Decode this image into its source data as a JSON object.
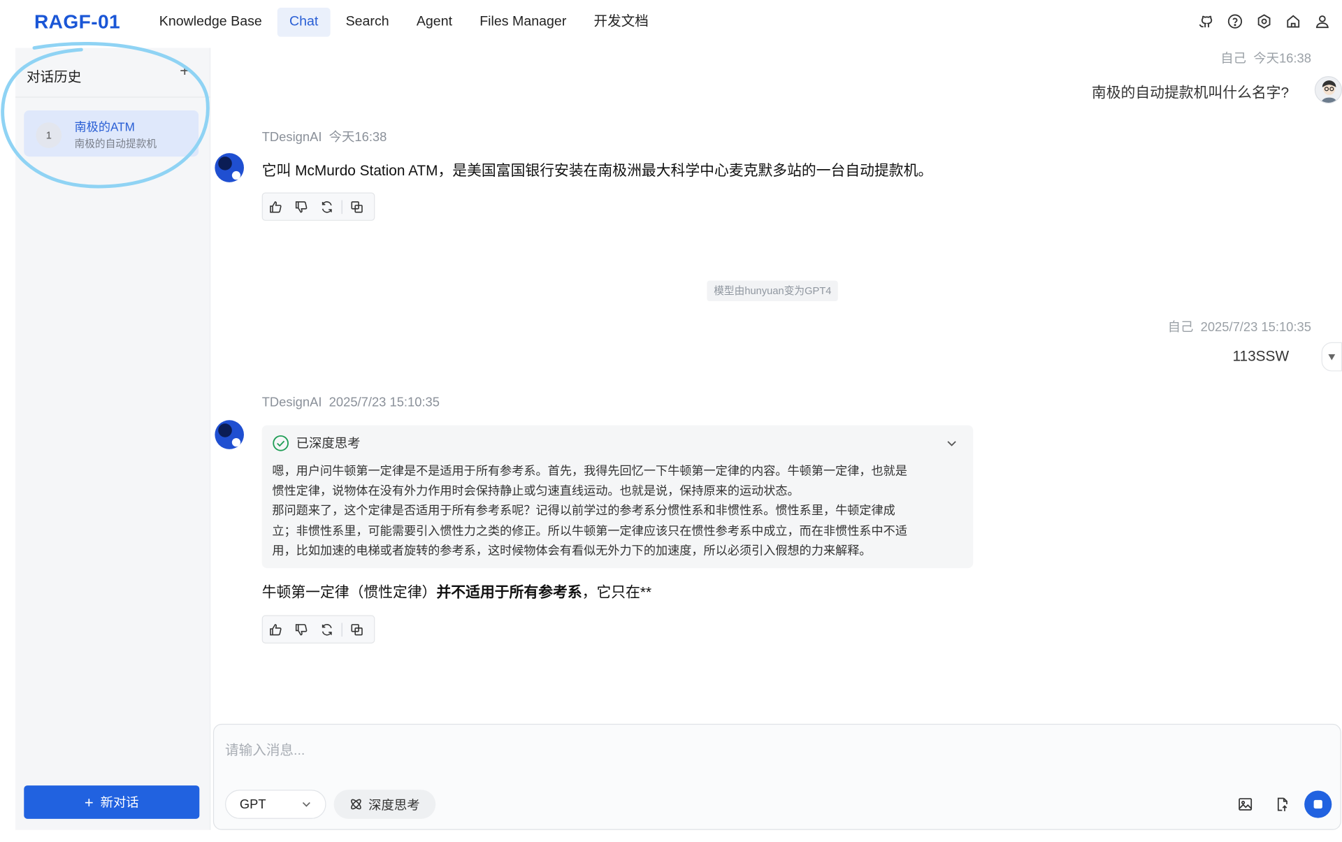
{
  "header": {
    "brand": "RAGF-01",
    "nav": [
      "Knowledge Base",
      "Chat",
      "Search",
      "Agent",
      "Files Manager",
      "开发文档"
    ],
    "active_nav": "Chat",
    "icons": [
      "github-icon",
      "help-icon",
      "settings-icon",
      "home-icon",
      "user-icon"
    ]
  },
  "sidebar": {
    "title": "对话历史",
    "add_symbol": "+",
    "conversations": [
      {
        "number": "1",
        "title": "南极的ATM",
        "subtitle": "南极的自动提款机"
      }
    ],
    "new_chat_label": "新对话"
  },
  "chat": {
    "messages": [
      {
        "role": "user",
        "sender": "自己",
        "time": "今天16:38",
        "text": "南极的自动提款机叫什么名字?"
      },
      {
        "role": "assistant",
        "sender": "TDesignAI",
        "time": "今天16:38",
        "text": "它叫 McMurdo Station ATM，是美国富国银行安装在南极洲最大科学中心麦克默多站的一台自动提款机。"
      },
      {
        "role": "system",
        "text": "模型由hunyuan变为GPT4"
      },
      {
        "role": "user",
        "sender": "自己",
        "time": "2025/7/23 15:10:35",
        "text": "113SSW"
      },
      {
        "role": "assistant",
        "sender": "TDesignAI",
        "time": "2025/7/23 15:10:35",
        "thinking_title": "已深度思考",
        "thinking_lines": [
          "嗯，用户问牛顿第一定律是不是适用于所有参考系。首先，我得先回忆一下牛顿第一定律的内容。牛顿第一定律，也就是",
          "惯性定律，说物体在没有外力作用时会保持静止或匀速直线运动。也就是说，保持原来的运动状态。",
          "那问题来了，这个定律是否适用于所有参考系呢？记得以前学过的参考系分惯性系和非惯性系。惯性系里，牛顿定律成",
          "立；非惯性系里，可能需要引入惯性力之类的修正。所以牛顿第一定律应该只在惯性参考系中成立，而在非惯性系中不适",
          "用，比如加速的电梯或者旋转的参考系，这时候物体会有看似无外力下的加速度，所以必须引入假想的力来解释。"
        ],
        "answer_prefix": "牛顿第一定律（惯性定律）",
        "answer_bold": "并不适用于所有参考系",
        "answer_suffix": "，它只在**"
      }
    ]
  },
  "input": {
    "placeholder": "请输入消息...",
    "model": "GPT",
    "deep_think_label": "深度思考"
  },
  "colors": {
    "accent": "#2162e0",
    "brand": "#1a56d6",
    "annotation": "#8fd3f4"
  }
}
